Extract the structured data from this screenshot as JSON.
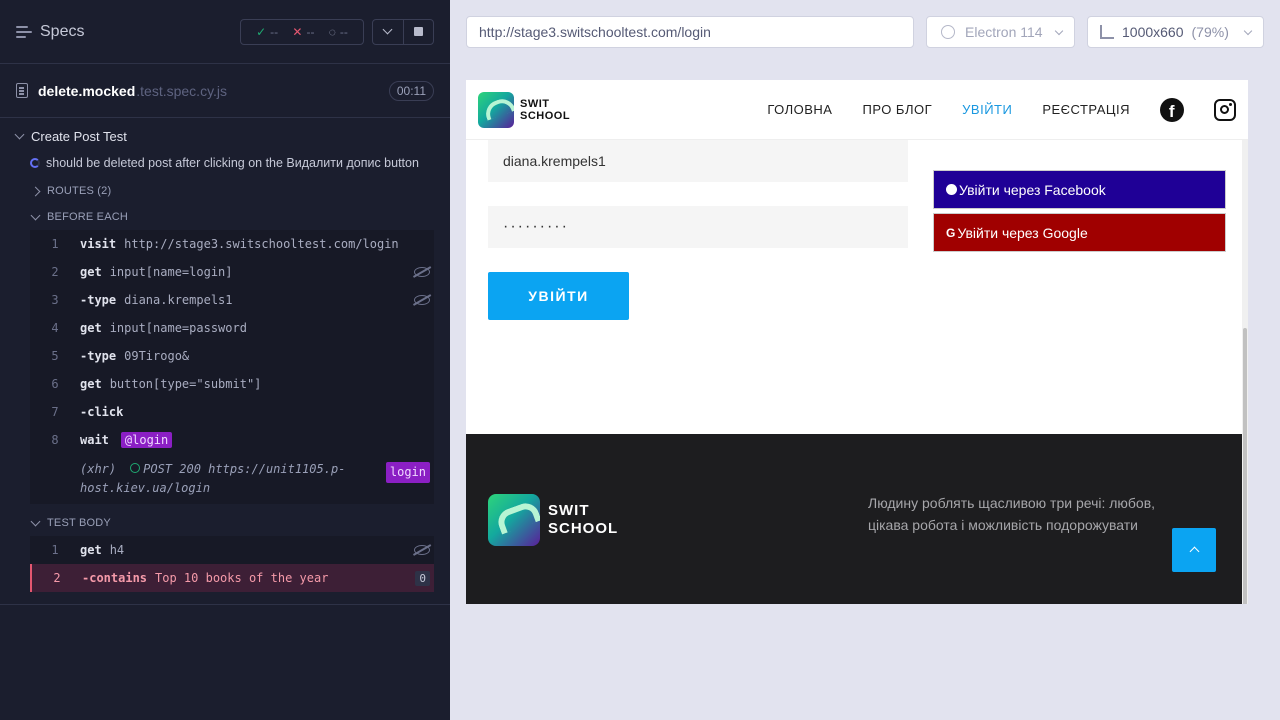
{
  "reporter": {
    "header": {
      "title": "Specs",
      "passed": "--",
      "failed": "--",
      "pending": "--"
    },
    "spec": {
      "name": "delete.mocked",
      "ext": ".test.spec.cy.js",
      "duration": "00:11"
    },
    "suite": {
      "title": "Create Post Test",
      "test_title": "should be deleted post after clicking on the Видалити допис button",
      "routes_label": "ROUTES (2)",
      "before_each_label": "BEFORE EACH",
      "test_body_label": "TEST BODY"
    },
    "before_each": [
      {
        "num": "1",
        "name": "visit",
        "msg": "http://stage3.switschooltest.com/login",
        "alias": "",
        "hidden_icon": false
      },
      {
        "num": "2",
        "name": "get",
        "msg": "input[name=login]",
        "alias": "",
        "hidden_icon": true
      },
      {
        "num": "3",
        "name": "-type",
        "msg": "diana.krempels1",
        "alias": "",
        "hidden_icon": true
      },
      {
        "num": "4",
        "name": "get",
        "msg": "input[name=password",
        "alias": "",
        "hidden_icon": false
      },
      {
        "num": "5",
        "name": "-type",
        "msg": "09Tirogo&",
        "alias": "",
        "hidden_icon": false
      },
      {
        "num": "6",
        "name": "get",
        "msg": "button[type=\"submit\"]",
        "alias": "",
        "hidden_icon": false
      },
      {
        "num": "7",
        "name": "-click",
        "msg": "",
        "alias": "",
        "hidden_icon": false
      },
      {
        "num": "8",
        "name": "wait",
        "msg": "",
        "alias": "@login",
        "hidden_icon": false
      }
    ],
    "xhr": {
      "kind": "(xhr)",
      "text": "POST 200 https://unit1105.p-host.kiev.ua/login",
      "tag": "login"
    },
    "test_body": [
      {
        "num": "1",
        "name": "get",
        "msg": "h4",
        "hidden_icon": true
      },
      {
        "num": "2",
        "name": "-contains",
        "msg": "Top 10 books of the year",
        "count": "0"
      }
    ]
  },
  "aut": {
    "url": "http://stage3.switschooltest.com/login",
    "browser": "Electron 114",
    "viewport": "1000x660",
    "viewport_pct": "(79%)",
    "site": {
      "logo_line1": "SWIT",
      "logo_line2": "SCHOOL",
      "nav": [
        "ГОЛОВНА",
        "ПРО БЛОГ",
        "УВІЙТИ",
        "РЕЄСТРАЦІЯ"
      ],
      "login_value": "diana.krempels1",
      "password_value": "·········",
      "submit_label": "УВІЙТИ",
      "fb_login_label": "Увійти через Facebook",
      "google_login_label": "Увійти через Google",
      "footer_quote": "Людину роблять щасливою три речі: любов, цікава робота і можливість подорожувати",
      "colors": {
        "accent": "#0ba4f2",
        "facebook": "#1f0096",
        "google": "#a00000",
        "footer": "#1d1d1f"
      }
    }
  }
}
